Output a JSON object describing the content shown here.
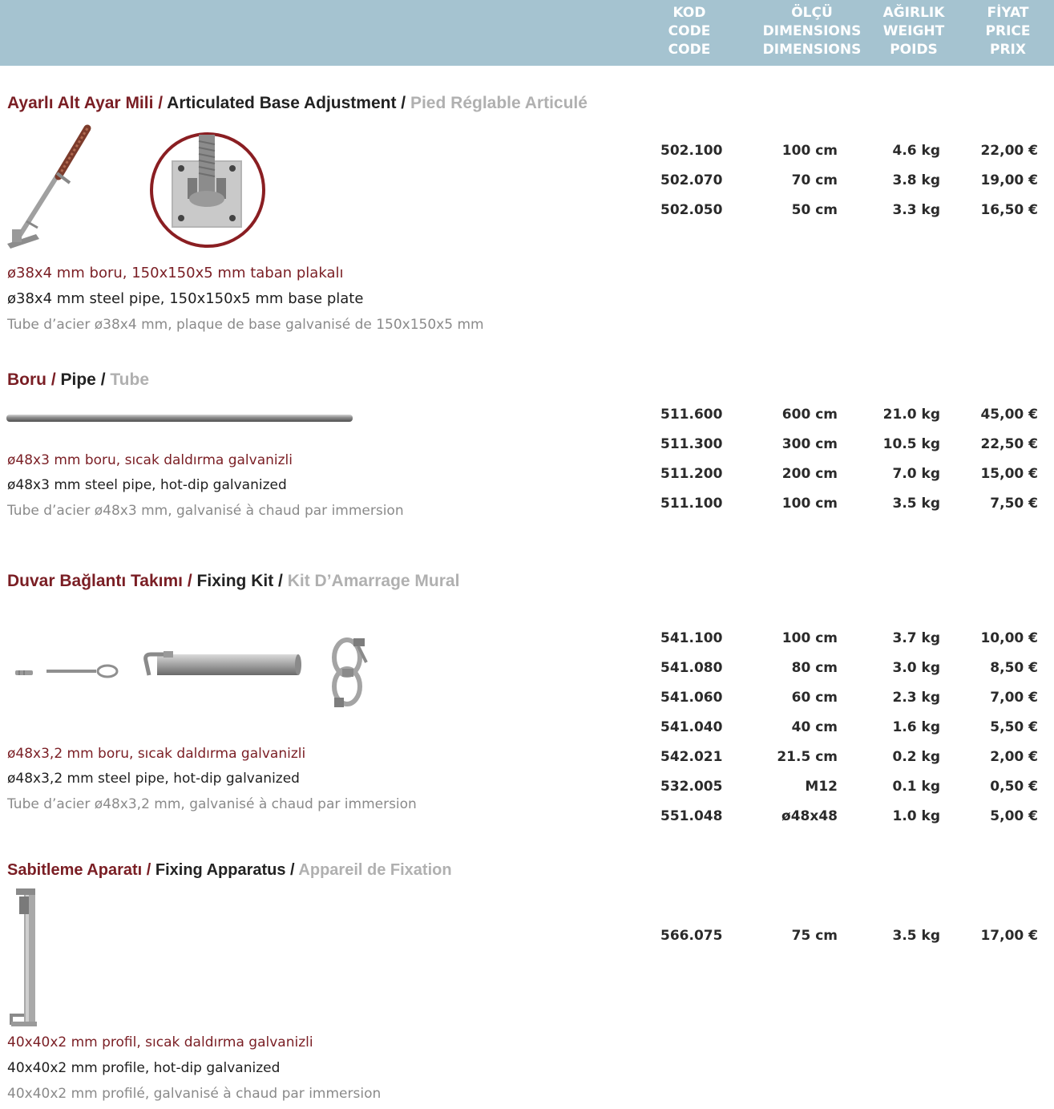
{
  "header": {
    "code": [
      "KOD",
      "CODE",
      "CODE"
    ],
    "dimensions": [
      "ÖLÇÜ",
      "DIMENSIONS",
      "DIMENSIONS"
    ],
    "weight": [
      "AĞIRLIK",
      "WEIGHT",
      "POIDS"
    ],
    "price": [
      "FİYAT",
      "PRICE",
      "PRIX"
    ]
  },
  "sections": [
    {
      "title_tr": "Ayarlı Alt Ayar Mili",
      "title_en": "Articulated Base Adjustment",
      "title_fr": "Pied Réglable Articulé",
      "desc_tr": "ø38x4 mm boru, 150x150x5 mm taban plakalı",
      "desc_en": "ø38x4 mm steel pipe, 150x150x5 mm base plate",
      "desc_fr": "Tube d’acier ø38x4 mm, plaque de base galvanisé  de 150x150x5 mm",
      "rows": [
        {
          "code": "502.100",
          "dim": "100 cm",
          "weight": "4.6 kg",
          "price": "22,00 €"
        },
        {
          "code": "502.070",
          "dim": "70 cm",
          "weight": "3.8 kg",
          "price": "19,00 €"
        },
        {
          "code": "502.050",
          "dim": "50 cm",
          "weight": "3.3 kg",
          "price": "16,50 €"
        }
      ]
    },
    {
      "title_tr": "Boru",
      "title_en": "Pipe",
      "title_fr": "Tube",
      "desc_tr": "ø48x3 mm boru, sıcak daldırma galvanizli",
      "desc_en": "ø48x3 mm steel pipe, hot-dip galvanized",
      "desc_fr": "Tube d’acier ø48x3 mm, galvanisé  à chaud par immersion",
      "rows": [
        {
          "code": "511.600",
          "dim": "600 cm",
          "weight": "21.0 kg",
          "price": "45,00 €"
        },
        {
          "code": "511.300",
          "dim": "300 cm",
          "weight": "10.5 kg",
          "price": "22,50 €"
        },
        {
          "code": "511.200",
          "dim": "200 cm",
          "weight": "7.0 kg",
          "price": "15,00 €"
        },
        {
          "code": "511.100",
          "dim": "100 cm",
          "weight": "3.5 kg",
          "price": "7,50 €"
        }
      ]
    },
    {
      "title_tr": "Duvar Bağlantı Takımı",
      "title_en": "Fixing Kit",
      "title_fr": "Kit D’Amarrage Mural",
      "desc_tr": "ø48x3,2 mm boru, sıcak daldırma galvanizli",
      "desc_en": "ø48x3,2 mm steel pipe, hot-dip galvanized",
      "desc_fr": "Tube d’acier ø48x3,2 mm, galvanisé à chaud par immersion",
      "rows": [
        {
          "code": "541.100",
          "dim": "100 cm",
          "weight": "3.7 kg",
          "price": "10,00 €"
        },
        {
          "code": "541.080",
          "dim": "80 cm",
          "weight": "3.0 kg",
          "price": "8,50 €"
        },
        {
          "code": "541.060",
          "dim": "60 cm",
          "weight": "2.3 kg",
          "price": "7,00 €"
        },
        {
          "code": "541.040",
          "dim": "40 cm",
          "weight": "1.6 kg",
          "price": "5,50 €"
        },
        {
          "code": "542.021",
          "dim": "21.5 cm",
          "weight": "0.2 kg",
          "price": "2,00 €"
        },
        {
          "code": "532.005",
          "dim": "M12",
          "weight": "0.1 kg",
          "price": "0,50 €"
        },
        {
          "code": "551.048",
          "dim": "ø48x48",
          "weight": "1.0 kg",
          "price": "5,00 €"
        }
      ]
    },
    {
      "title_tr": "Sabitleme Aparatı",
      "title_en": "Fixing Apparatus",
      "title_fr": "Appareil de Fixation",
      "desc_tr": "40x40x2 mm profil, sıcak daldırma galvanizli",
      "desc_en": "40x40x2 mm profile, hot-dip galvanized",
      "desc_fr": "40x40x2 mm profilé, galvanisé à chaud par immersion",
      "rows": [
        {
          "code": "566.075",
          "dim": "75 cm",
          "weight": "3.5 kg",
          "price": "17,00 €"
        }
      ]
    }
  ],
  "colors": {
    "header_bg": "#a5c3d0",
    "title_red": "#7a1e24",
    "title_dark": "#222222",
    "title_grey": "#b0b0b0",
    "desc_grey": "#8a8a8a"
  },
  "icons": [
    "base-jack-photo",
    "base-plate-detail-photo",
    "steel-pipe-photo",
    "anchor-bolt-photo",
    "eye-bolt-photo",
    "wall-tie-tube-photo",
    "coupler-clamp-photo",
    "fixing-bracket-photo"
  ]
}
